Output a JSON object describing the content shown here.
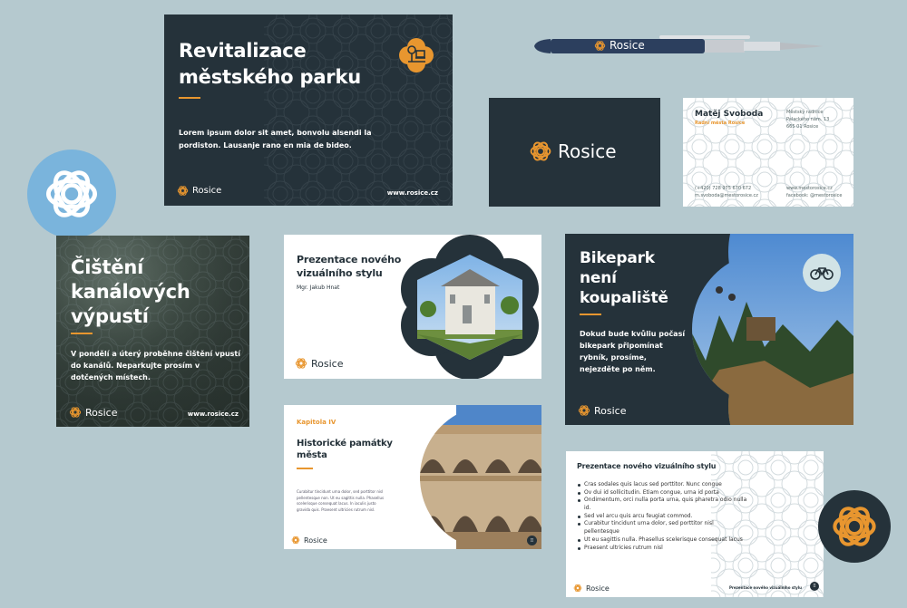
{
  "brand": {
    "name": "Rosice",
    "colors": {
      "dark": "#25323a",
      "orange": "#e8962f",
      "background": "#b5c9cf",
      "blue_badge": "#7ab4dc",
      "light_badge": "#d1e3e6"
    }
  },
  "park_card": {
    "title": "Revitalizace městského parku",
    "body": "Lorem ipsum dolor sit amet, bonvolu alsendi la pordiston. Lausanje rano en mia de bideo.",
    "logo": "Rosice",
    "url": "www.rosice.cz",
    "icon": "park-tree-bench-icon"
  },
  "pen": {
    "logo": "Rosice"
  },
  "logo_card": {
    "logo": "Rosice"
  },
  "business_card": {
    "name": "Matěj Svoboda",
    "role": "Radní města Rosice",
    "address": [
      "Městský radnice",
      "Palackého nám. 13",
      "665 01 Rosice"
    ],
    "phone": "(+420) 728 975 670 672",
    "email": "m.svoboda@mestorosice.cz",
    "web": "www.mestorosice.cz",
    "facebook": "facebook: @mestorosice"
  },
  "channel_card": {
    "title": "Čištění kanálových výpustí",
    "body": "V pondělí a úterý proběhne čištění vpustí do kanálů. Neparkujte prosím v dotčených místech.",
    "logo": "Rosice",
    "url": "www.rosice.cz"
  },
  "presentation_card": {
    "title": "Prezentace nového vizuálního stylu",
    "author": "Mgr. Jakub Hnat",
    "logo": "Rosice"
  },
  "bikepark_card": {
    "title": "Bikepark není koupaliště",
    "body": "Dokud bude kvůliu počasí bikepark připomínat rybník, prosíme, nejezděte po něm.",
    "logo": "Rosice",
    "icon": "bicycle-icon"
  },
  "history_card": {
    "chapter": "Kapitola IV",
    "title": "Historické památky města",
    "body": "Curabitur tincidunt urna dolor, sed porttitor nisl pellentesque non. Ut eu sagittis nulla. Phasellus scelerisque consequat lacus. In iaculis justo gravida quis. Praesent ultricies rutrum nisl.",
    "logo": "Rosice",
    "page_icon": "grid-icon"
  },
  "slide_card": {
    "title": "Prezentace nového vizuálního stylu",
    "bullets": [
      "Cras sodales quis lacus sed porttitor. Nunc congue",
      "Ov dui id sollicitudin. Etiam congue, urna id porta",
      "Ondimentum, orci nulla porta urna, quis pharetra odio nulla id.",
      "Sed vel arcu quis arcu feugiat commod.",
      "Curabitur tincidunt urna dolor, sed porttitor nisl pellentesque",
      "Ut eu sagittis nulla. Phasellus scelerisque consequat lacus",
      "Praesent ultricies rutrum nisl"
    ],
    "logo": "Rosice",
    "footer": "Prezentace nového vizuálního stylu"
  }
}
